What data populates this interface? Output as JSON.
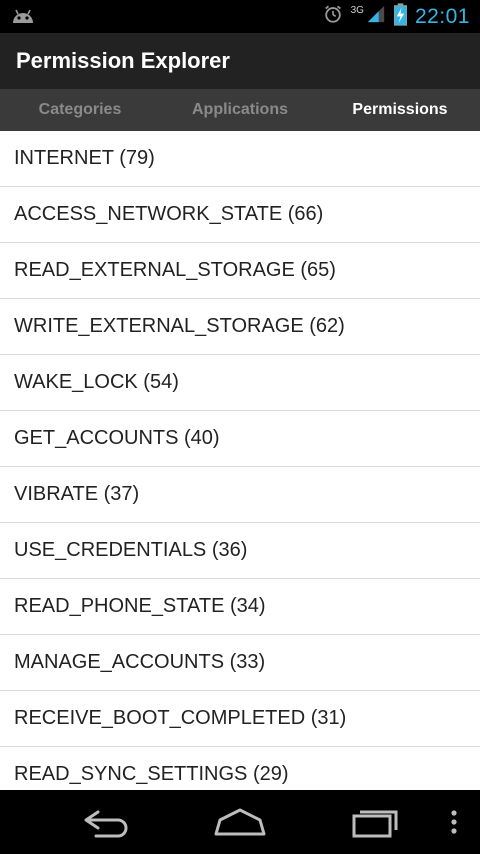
{
  "status_bar": {
    "network": "3G",
    "time": "22:01",
    "icons": [
      "android-icon",
      "alarm-icon",
      "signal-icon",
      "battery-charging-icon"
    ]
  },
  "action_bar": {
    "title": "Permission Explorer"
  },
  "tabs": [
    {
      "label": "Categories",
      "active": false
    },
    {
      "label": "Applications",
      "active": false
    },
    {
      "label": "Permissions",
      "active": true
    }
  ],
  "permissions": [
    {
      "label": "INTERNET (79)"
    },
    {
      "label": "ACCESS_NETWORK_STATE (66)"
    },
    {
      "label": "READ_EXTERNAL_STORAGE (65)"
    },
    {
      "label": "WRITE_EXTERNAL_STORAGE (62)"
    },
    {
      "label": "WAKE_LOCK (54)"
    },
    {
      "label": "GET_ACCOUNTS (40)"
    },
    {
      "label": "VIBRATE (37)"
    },
    {
      "label": "USE_CREDENTIALS (36)"
    },
    {
      "label": "READ_PHONE_STATE (34)"
    },
    {
      "label": "MANAGE_ACCOUNTS (33)"
    },
    {
      "label": "RECEIVE_BOOT_COMPLETED (31)"
    },
    {
      "label": "READ_SYNC_SETTINGS (29)"
    }
  ],
  "nav_bar": {
    "buttons": [
      "back-icon",
      "home-icon",
      "recent-apps-icon",
      "overflow-menu-icon"
    ]
  },
  "colors": {
    "status_accent": "#33b5e5",
    "action_bar_bg": "#222222",
    "tab_bar_bg": "#3a3a3a",
    "active_tab_text": "#ffffff",
    "inactive_tab_text": "#8a8a8a"
  }
}
